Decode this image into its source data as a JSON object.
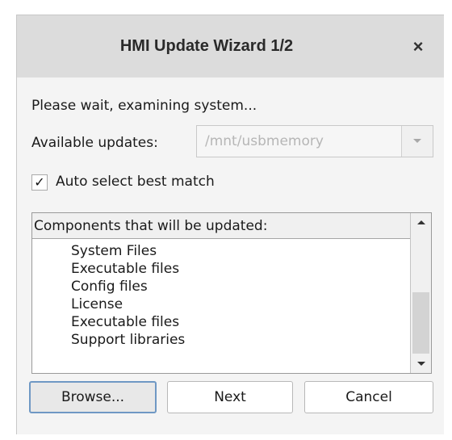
{
  "window": {
    "title": "HMI Update Wizard 1/2",
    "close_glyph": "×"
  },
  "status_text": "Please wait, examining system...",
  "available_updates": {
    "label": "Available updates:",
    "selected_value": "/mnt/usbmemory",
    "enabled": false
  },
  "auto_select": {
    "label": "Auto select best match",
    "checked": true,
    "check_glyph": "✓"
  },
  "components": {
    "header": "Components that will be updated:",
    "items": [
      "System Files",
      "Executable files",
      "Config files",
      "License",
      "Executable files",
      "Support libraries"
    ]
  },
  "buttons": {
    "browse": "Browse...",
    "next": "Next",
    "cancel": "Cancel"
  },
  "icons": {
    "close": "close-icon",
    "dropdown": "chevron-down-icon",
    "scroll_up": "arrow-up-icon",
    "scroll_down": "arrow-down-icon"
  },
  "colors": {
    "titlebar": "#dcdcdc",
    "dialog_bg": "#f4f4f4",
    "default_button_border": "#6f98c4",
    "disabled_text": "#b6b6b6"
  }
}
